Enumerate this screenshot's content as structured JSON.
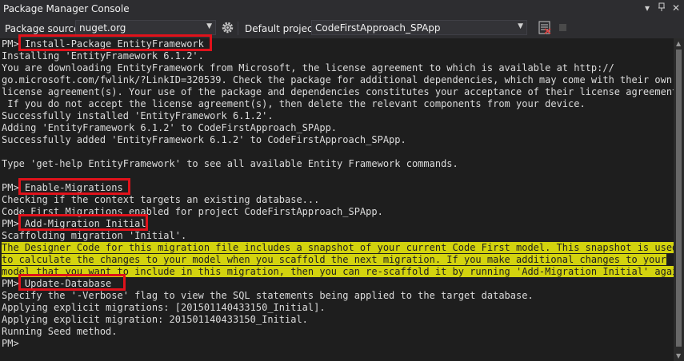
{
  "window": {
    "title": "Package Manager Console"
  },
  "toolbar": {
    "source_label": "Package source:",
    "source_value": "nuget.org",
    "project_label": "Default project:",
    "project_value": "CodeFirstApproach_SPApp"
  },
  "console": {
    "lines": [
      "PM> Install-Package EntityFramework",
      "Installing 'EntityFramework 6.1.2'.",
      "You are downloading EntityFramework from Microsoft, the license agreement to which is available at http://",
      "go.microsoft.com/fwlink/?LinkID=320539. Check the package for additional dependencies, which may come with their own",
      "license agreement(s). Your use of the package and dependencies constitutes your acceptance of their license agreements.",
      " If you do not accept the license agreement(s), then delete the relevant components from your device.",
      "Successfully installed 'EntityFramework 6.1.2'.",
      "Adding 'EntityFramework 6.1.2' to CodeFirstApproach_SPApp.",
      "Successfully added 'EntityFramework 6.1.2' to CodeFirstApproach_SPApp.",
      "",
      "Type 'get-help EntityFramework' to see all available Entity Framework commands.",
      "",
      "PM> Enable-Migrations",
      "Checking if the context targets an existing database...",
      "Code First Migrations enabled for project CodeFirstApproach_SPApp.",
      "PM> Add-Migration Initial",
      "Scaffolding migration 'Initial'.",
      "The Designer Code for this migration file includes a snapshot of your current Code First model. This snapshot is used",
      "to calculate the changes to your model when you scaffold the next migration. If you make additional changes to your",
      "model that you want to include in this migration, then you can re-scaffold it by running 'Add-Migration Initial' again.",
      "PM> Update-Database",
      "Specify the '-Verbose' flag to view the SQL statements being applied to the target database.",
      "Applying explicit migrations: [201501140433150_Initial].",
      "Applying explicit migration: 201501140433150_Initial.",
      "Running Seed method.",
      "PM>"
    ],
    "highlight_color": "#d3d30e",
    "box_color": "#e0121b"
  },
  "icons": {
    "settings": "gear-icon",
    "clear": "clear-console-icon",
    "stop": "stop-icon",
    "dropdown": "chevron-down-icon",
    "pin": "pin-icon",
    "close": "close-icon"
  }
}
